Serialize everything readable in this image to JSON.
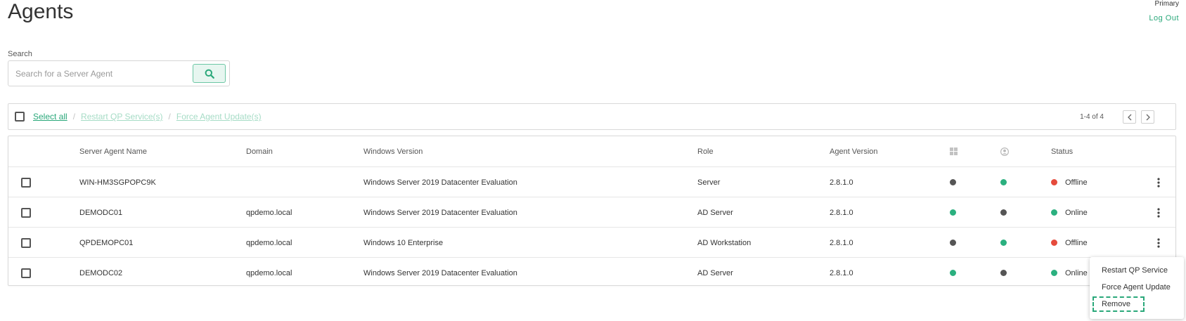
{
  "header": {
    "title": "Agents",
    "user": "Primary",
    "logout": "Log Out"
  },
  "search": {
    "label": "Search",
    "placeholder": "Search for a Server Agent",
    "value": ""
  },
  "bulk_actions": {
    "select_all": "Select all",
    "separator": "/",
    "restart": "Restart QP Service(s)",
    "force_update": "Force Agent Update(s)",
    "pagination": "1-4 of 4"
  },
  "table": {
    "columns": {
      "name": "Server Agent Name",
      "domain": "Domain",
      "windows": "Windows Version",
      "role": "Role",
      "version": "Agent Version",
      "status": "Status"
    },
    "rows": [
      {
        "name": "WIN-HM3SGPOPC9K",
        "domain": "",
        "windows": "Windows Server 2019 Datacenter Evaluation",
        "role": "Server",
        "version": "2.8.1.0",
        "os_state": "dark",
        "user_state": "green",
        "status": "Offline",
        "status_state": "red"
      },
      {
        "name": "DEMODC01",
        "domain": "qpdemo.local",
        "windows": "Windows Server 2019 Datacenter Evaluation",
        "role": "AD Server",
        "version": "2.8.1.0",
        "os_state": "green",
        "user_state": "dark",
        "status": "Online",
        "status_state": "green"
      },
      {
        "name": "QPDEMOPC01",
        "domain": "qpdemo.local",
        "windows": "Windows 10 Enterprise",
        "role": "AD Workstation",
        "version": "2.8.1.0",
        "os_state": "dark",
        "user_state": "green",
        "status": "Offline",
        "status_state": "red"
      },
      {
        "name": "DEMODC02",
        "domain": "qpdemo.local",
        "windows": "Windows Server 2019 Datacenter Evaluation",
        "role": "AD Server",
        "version": "2.8.1.0",
        "os_state": "green",
        "user_state": "dark",
        "status": "Online",
        "status_state": "green"
      }
    ]
  },
  "context_menu": {
    "restart": "Restart QP Service",
    "force_update": "Force Agent Update",
    "remove": "Remove"
  },
  "icons": {
    "search": "search-icon",
    "windows": "windows-icon",
    "user": "user-icon",
    "more": "more-vertical-icon",
    "prev": "chevron-left-icon",
    "next": "chevron-right-icon"
  },
  "colors": {
    "accent": "#2aa87a",
    "green": "#2bb07f",
    "red": "#e54b3c",
    "dark": "#555555"
  }
}
